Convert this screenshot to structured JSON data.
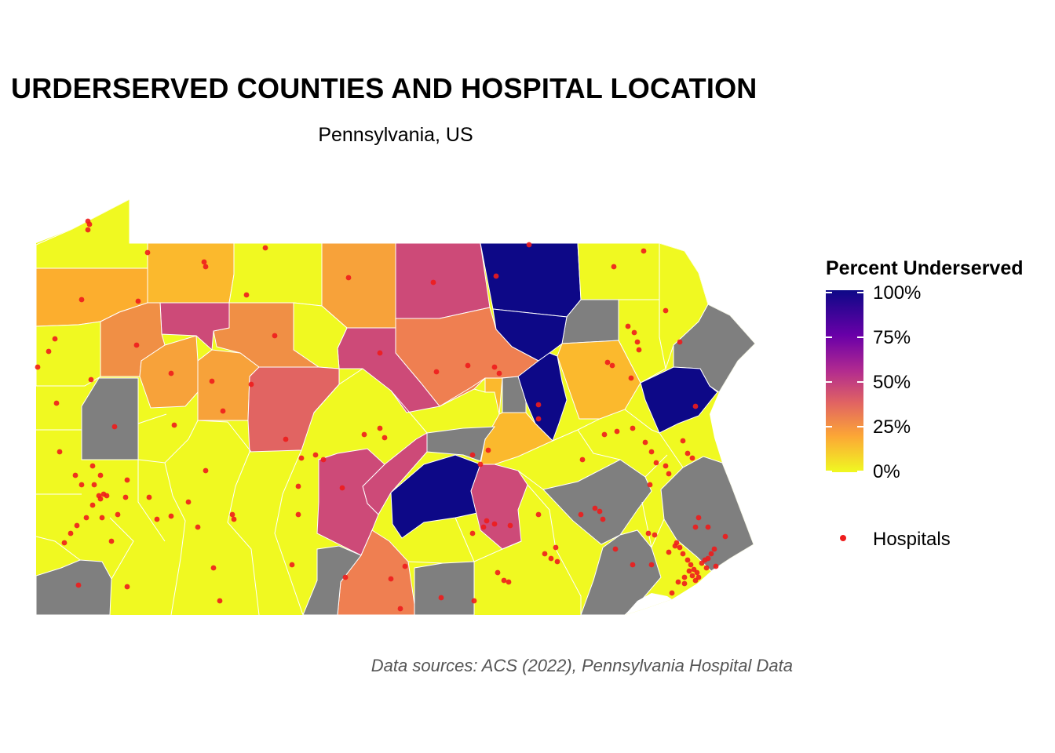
{
  "title": "URDERSERVED COUNTIES AND HOSPITAL LOCATION",
  "subtitle": "Pennsylvania, US",
  "caption": "Data sources: ACS (2022), Pennsylvania Hospital Data",
  "legend": {
    "fill_title": "Percent Underserved",
    "fill_ticks": [
      "100%",
      "75%",
      "50%",
      "25%",
      "0%"
    ],
    "point_label": "Hospitals"
  },
  "colors": {
    "no_data": "#7f7f7f",
    "hospital": "#ee1c1c",
    "scale": [
      "#f0f921",
      "#fca636",
      "#e16462",
      "#b12a90",
      "#6a00a8",
      "#0d0887"
    ]
  }
}
